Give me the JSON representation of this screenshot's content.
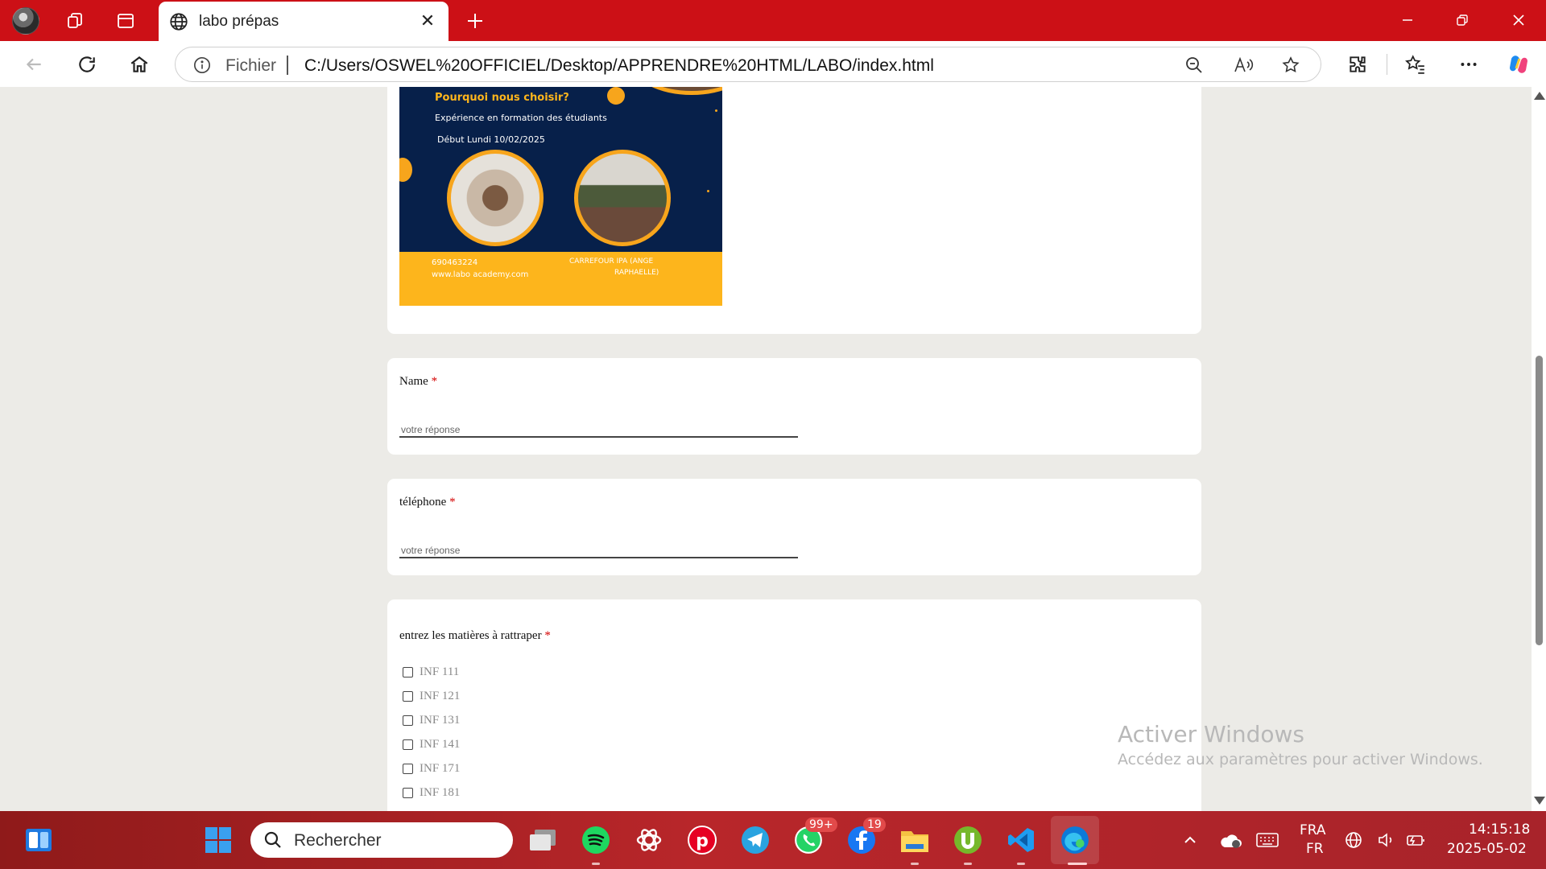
{
  "browser": {
    "tab_title": "labo prépas",
    "omnibox_file_label": "Fichier",
    "url": "C:/Users/OSWEL%20OFFICIEL/Desktop/APPRENDRE%20HTML/LABO/index.html"
  },
  "flyer": {
    "heading": "Pourquoi nous choisir?",
    "line1": "Expérience en formation des étudiants",
    "line2": "Début Lundi 10/02/2025",
    "phone": "690463224",
    "website": "www.labo academy.com",
    "address_line1": "CARREFOUR IPA (ANGE",
    "address_line2": "RAPHAELLE)"
  },
  "form": {
    "required_mark": "*",
    "name_label": "Name",
    "name_placeholder": "votre réponse",
    "phone_label": "téléphone",
    "phone_placeholder": "votre réponse",
    "subjects_label": "entrez les matières à rattraper",
    "subjects": [
      "INF 111",
      "INF 121",
      "INF 131",
      "INF 141",
      "INF 171",
      "INF 181"
    ]
  },
  "watermark": {
    "title": "Activer Windows",
    "subtitle": "Accédez aux paramètres pour activer Windows."
  },
  "taskbar": {
    "search_placeholder": "Rechercher",
    "whatsapp_badge": "99+",
    "facebook_badge": "19",
    "lang_top": "FRA",
    "lang_bottom": "FR",
    "time": "14:15:18",
    "date": "2025-05-02"
  },
  "colors": {
    "titlebar": "#cc1016",
    "flyer_navy": "#07204a",
    "flyer_yellow": "#fdb51c",
    "required": "#d40000"
  }
}
